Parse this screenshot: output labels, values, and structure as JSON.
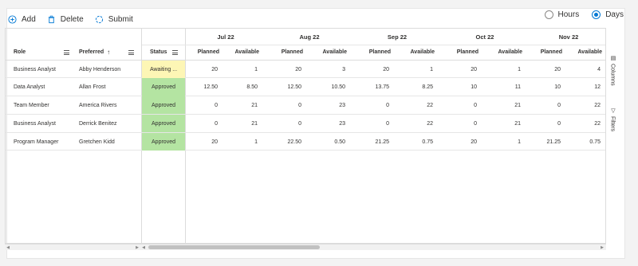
{
  "toolbar": {
    "add": "Add",
    "delete": "Delete",
    "submit": "Submit"
  },
  "view_toggle": {
    "hours": "Hours",
    "days": "Days",
    "selected": "Days"
  },
  "columns": {
    "role": "Role",
    "preferred": "Preferred",
    "status": "Status"
  },
  "months": [
    "Jul 22",
    "Aug 22",
    "Sep 22",
    "Oct 22",
    "Nov 22"
  ],
  "subcols": {
    "planned": "Planned",
    "available": "Available"
  },
  "rows": [
    {
      "role": "Business Analyst",
      "preferred": "Abby Henderson",
      "status": "Awaiting ...",
      "status_color": "#fdf6b5",
      "values": [
        "20",
        "1",
        "20",
        "3",
        "20",
        "1",
        "20",
        "1",
        "20",
        "4"
      ]
    },
    {
      "role": "Data Analyst",
      "preferred": "Allan Frost",
      "status": "Approved",
      "status_color": "#b4e4a2",
      "values": [
        "12.50",
        "8.50",
        "12.50",
        "10.50",
        "13.75",
        "8.25",
        "10",
        "11",
        "10",
        "12"
      ]
    },
    {
      "role": "Team Member",
      "preferred": "America Rivers",
      "status": "Approved",
      "status_color": "#b4e4a2",
      "values": [
        "0",
        "21",
        "0",
        "23",
        "0",
        "22",
        "0",
        "21",
        "0",
        "22"
      ]
    },
    {
      "role": "Business Analyst",
      "preferred": "Derrick Benitez",
      "status": "Approved",
      "status_color": "#b4e4a2",
      "values": [
        "0",
        "21",
        "0",
        "23",
        "0",
        "22",
        "0",
        "21",
        "0",
        "22"
      ]
    },
    {
      "role": "Program Manager",
      "preferred": "Gretchen Kidd",
      "status": "Approved",
      "status_color": "#b4e4a2",
      "values": [
        "20",
        "1",
        "22.50",
        "0.50",
        "21.25",
        "0.75",
        "20",
        "1",
        "21.25",
        "0.75"
      ]
    }
  ],
  "side_panel": {
    "columns": "Columns",
    "filters": "Filters"
  }
}
